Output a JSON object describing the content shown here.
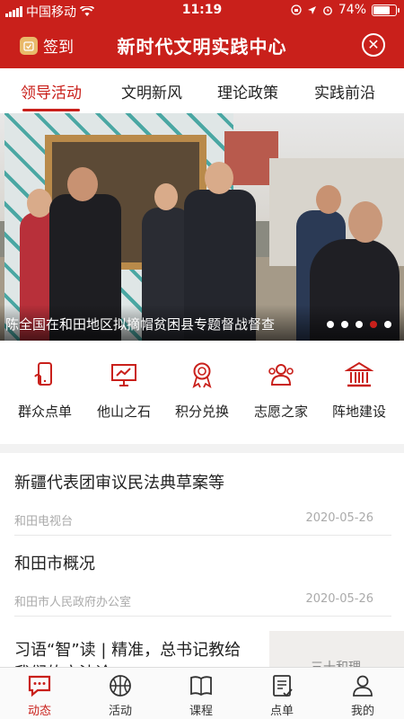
{
  "status_bar": {
    "carrier": "中国移动",
    "time": "11:19",
    "battery": "74%",
    "battery_level": 0.74
  },
  "header": {
    "signin_label": "签到",
    "title": "新时代文明实践中心"
  },
  "tabs": [
    {
      "label": "领导活动",
      "active": true
    },
    {
      "label": "文明新风",
      "active": false
    },
    {
      "label": "理论政策",
      "active": false
    },
    {
      "label": "实践前沿",
      "active": false
    }
  ],
  "banner": {
    "caption": "陈全国在和田地区拟摘帽贫困县专题督战督查",
    "dot_count": 5,
    "active_dot": 3
  },
  "quick_actions": [
    {
      "label": "群众点单",
      "icon": "phone-order-icon"
    },
    {
      "label": "他山之石",
      "icon": "presentation-board-icon"
    },
    {
      "label": "积分兑换",
      "icon": "award-medal-icon"
    },
    {
      "label": "志愿之家",
      "icon": "volunteers-icon"
    },
    {
      "label": "阵地建设",
      "icon": "building-icon"
    }
  ],
  "news": [
    {
      "title": "新疆代表团审议民法典草案等",
      "source": "和田电视台",
      "date": "2020-05-26"
    },
    {
      "title": "和田市概况",
      "source": "和田市人民政府办公室",
      "date": "2020-05-26"
    },
    {
      "title": "习语“智”读 | 精准，总书记教给我们的方法论",
      "thumb_text": "三十和理"
    }
  ],
  "bottom_nav": [
    {
      "label": "动态",
      "icon": "chat-icon",
      "active": true
    },
    {
      "label": "活动",
      "icon": "basketball-icon",
      "active": false
    },
    {
      "label": "课程",
      "icon": "book-icon",
      "active": false
    },
    {
      "label": "点单",
      "icon": "clipboard-icon",
      "active": false
    },
    {
      "label": "我的",
      "icon": "user-icon",
      "active": false
    }
  ],
  "colors": {
    "brand_red": "#c9201b"
  }
}
